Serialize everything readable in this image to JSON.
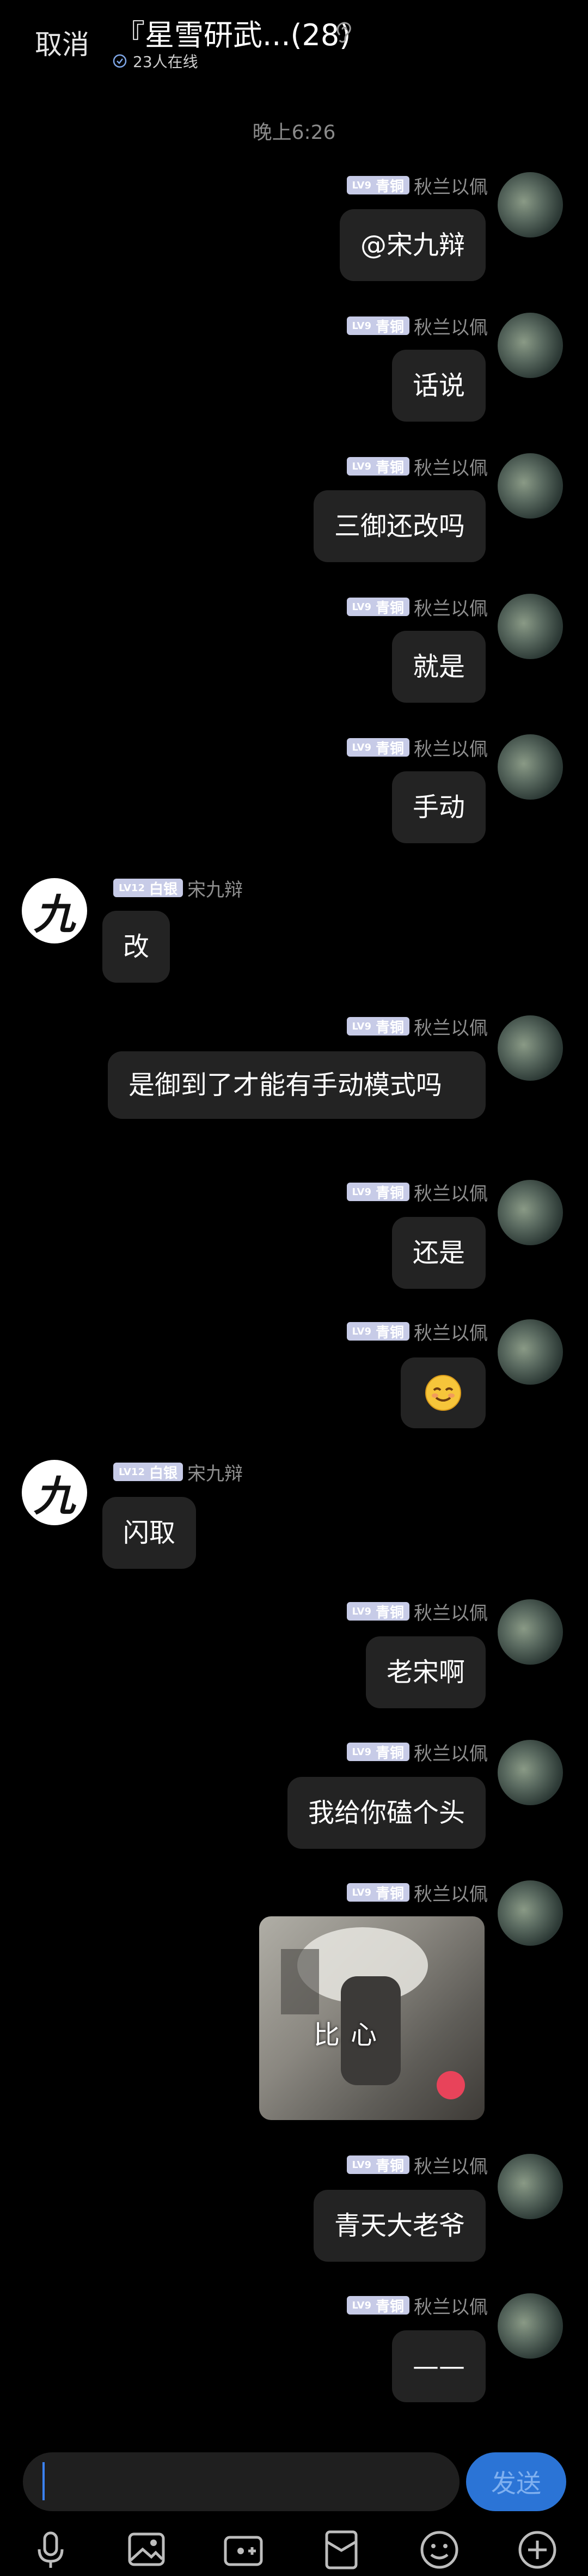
{
  "header": {
    "cancel_label": "取消",
    "title": "『星雪研武...(28)",
    "online": "23人在线"
  },
  "time_label": "晚上6:26",
  "users": {
    "self": {
      "level": "LV9",
      "rank": "青铜",
      "name": "秋兰以佩"
    },
    "song": {
      "level": "LV12",
      "rank": "白银",
      "name": "宋九辩"
    }
  },
  "messages": [
    {
      "text": "@宋九辩"
    },
    {
      "text": "话说"
    },
    {
      "text": "三御还改吗"
    },
    {
      "text": "就是"
    },
    {
      "text": "手动"
    },
    {
      "text": "改"
    },
    {
      "text": "是御到了才能有手动模式吗"
    },
    {
      "text": "还是"
    },
    {
      "text": "😌"
    },
    {
      "text": "闪取"
    },
    {
      "text": "老宋啊"
    },
    {
      "text": "我给你磕个头"
    },
    {
      "sticker_text": "比心"
    },
    {
      "text": "青天大老爷"
    },
    {
      "text": "——"
    }
  ],
  "input": {
    "send_label": "发送"
  },
  "avatar_song_glyph": "九",
  "icons": [
    "voice-icon",
    "image-icon",
    "camera-icon",
    "red-packet-icon",
    "emoji-icon",
    "plus-icon"
  ],
  "colors": {
    "badge": "#c7cbe7",
    "send": "#2b74d6",
    "bubble": "#232323"
  }
}
